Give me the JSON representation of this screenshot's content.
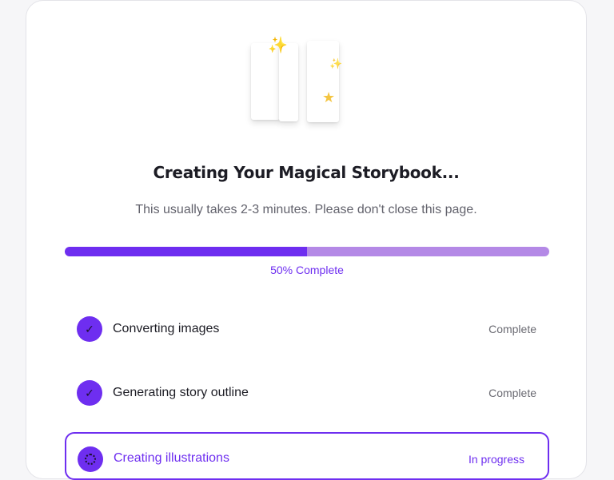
{
  "header": {
    "title": "Creating Your Magical Storybook...",
    "subtitle": "This usually takes 2-3 minutes. Please don't close this page."
  },
  "progress": {
    "value": 0.5,
    "label": "50% Complete"
  },
  "steps": [
    {
      "label": "Converting images",
      "status": "Complete",
      "icon": "check-icon"
    },
    {
      "label": "Generating story outline",
      "status": "Complete",
      "icon": "check-icon"
    },
    {
      "label": "Creating illustrations",
      "status": "In progress",
      "icon": "spinner-icon"
    }
  ],
  "colors": {
    "accent": "#6e2ef0",
    "progress_track": "#b489e6"
  }
}
